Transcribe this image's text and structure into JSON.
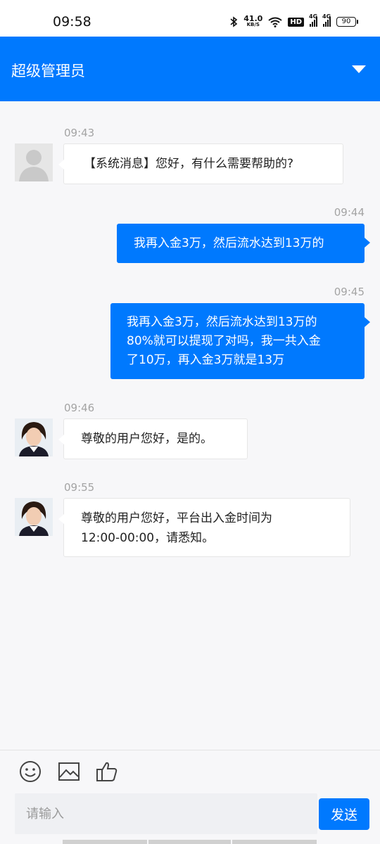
{
  "status_bar": {
    "time": "09:58",
    "net_speed": "41.0",
    "net_unit": "KB/S",
    "hd": "HD",
    "sig1": "4G",
    "sig2": "4G",
    "battery": "90"
  },
  "header": {
    "title": "超级管理员",
    "dropdown_icon": "triangle-down-icon",
    "color": "#0079fe"
  },
  "messages": [
    {
      "time": "09:43",
      "from": "system",
      "text": "【系统消息】您好，有什么需要帮助的?"
    },
    {
      "time": "09:44",
      "from": "user",
      "lines": [
        "我再入金3万，然后流水达到13万的"
      ]
    },
    {
      "time": "09:45",
      "from": "user",
      "lines": [
        "我再入金3万，然后流水达到13万的",
        "80%就可以提现了对吗，我一共入金",
        "了10万，再入金3万就是13万"
      ]
    },
    {
      "time": "09:46",
      "from": "agent",
      "lines": [
        "尊敬的用户您好，是的。"
      ]
    },
    {
      "time": "09:55",
      "from": "agent",
      "lines": [
        "尊敬的用户您好，平台出入金时间为",
        "12:00-00:00，请悉知。"
      ]
    }
  ],
  "toolbar": {
    "emoji_icon": "smiley-icon",
    "image_icon": "image-icon",
    "like_icon": "thumbs-up-icon"
  },
  "composer": {
    "placeholder": "请输入",
    "send_label": "发送"
  }
}
